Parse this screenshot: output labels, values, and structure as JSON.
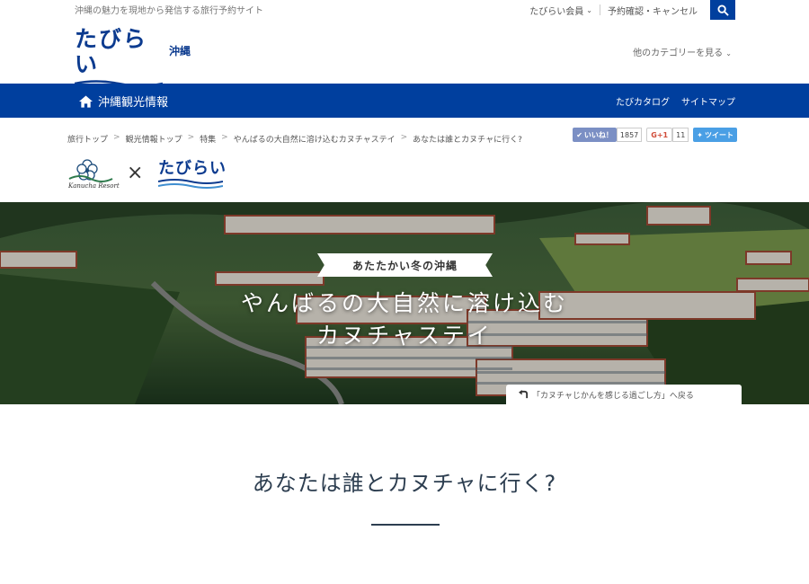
{
  "header": {
    "tagline": "沖縄の魅力を現地から発信する旅行予約サイト",
    "member_label": "たびらい会員",
    "reservation_label": "予約確認・キャンセル",
    "logo_text": "たびらい",
    "region_label": "沖縄",
    "other_category_label": "他のカテゴリーを見る"
  },
  "navbar": {
    "home_label": "沖縄観光情報",
    "catalog_label": "たびカタログ",
    "sitemap_label": "サイトマップ",
    "color": "#003f9e"
  },
  "breadcrumb": [
    "旅行トップ",
    "観光情報トップ",
    "特集",
    "やんばるの大自然に溶け込むカヌチャステイ",
    "あなたは誰とカヌチャに行く?"
  ],
  "social": {
    "like_label": "いいね！",
    "like_count": "1857",
    "gplus_label": "G+1",
    "gplus_count": "11",
    "tweet_label": "ツイート"
  },
  "collab": {
    "kanucha_label": "Kanucha Resort",
    "times": "×",
    "logo_text": "たびらい"
  },
  "hero": {
    "badge": "あたたかい冬の沖縄",
    "title_line1": "やんばるの大自然に溶け込む",
    "title_line2": "カヌチャステイ",
    "back_link": "「カヌチャじかんを感じる過ごし方」へ戻る"
  },
  "section": {
    "title": "あなたは誰とカヌチャに行く?"
  },
  "icons": {
    "search": "search-icon",
    "home": "home-icon",
    "back": "back-arrow-icon"
  }
}
